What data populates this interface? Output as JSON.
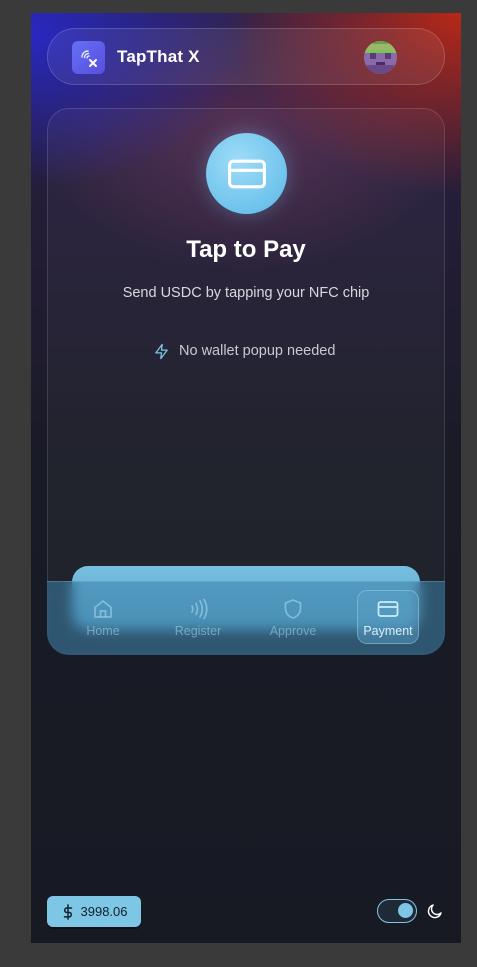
{
  "header": {
    "app_title": "TapThat X",
    "logo_icon": "nfc-tap-icon",
    "avatar_icon": "pixel-avatar-icon"
  },
  "payment_card": {
    "icon": "credit-card-icon",
    "title": "Tap to Pay",
    "subtitle": "Send USDC by tapping your NFC chip",
    "feature_icon": "lightning-icon",
    "feature_text": "No wallet popup needed"
  },
  "tabs": [
    {
      "label": "Home",
      "icon": "home-icon",
      "active": false
    },
    {
      "label": "Register",
      "icon": "nfc-waves-icon",
      "active": false
    },
    {
      "label": "Approve",
      "icon": "shield-icon",
      "active": false
    },
    {
      "label": "Payment",
      "icon": "credit-card-icon",
      "active": true
    }
  ],
  "footer": {
    "balance_icon": "dollar-icon",
    "balance_value": "3998.06",
    "theme_toggle_on": true,
    "theme_icon": "moon-icon"
  },
  "colors": {
    "accent": "#7ec6e6",
    "logo_tile": "#5a5fee",
    "background": "#171a23"
  }
}
